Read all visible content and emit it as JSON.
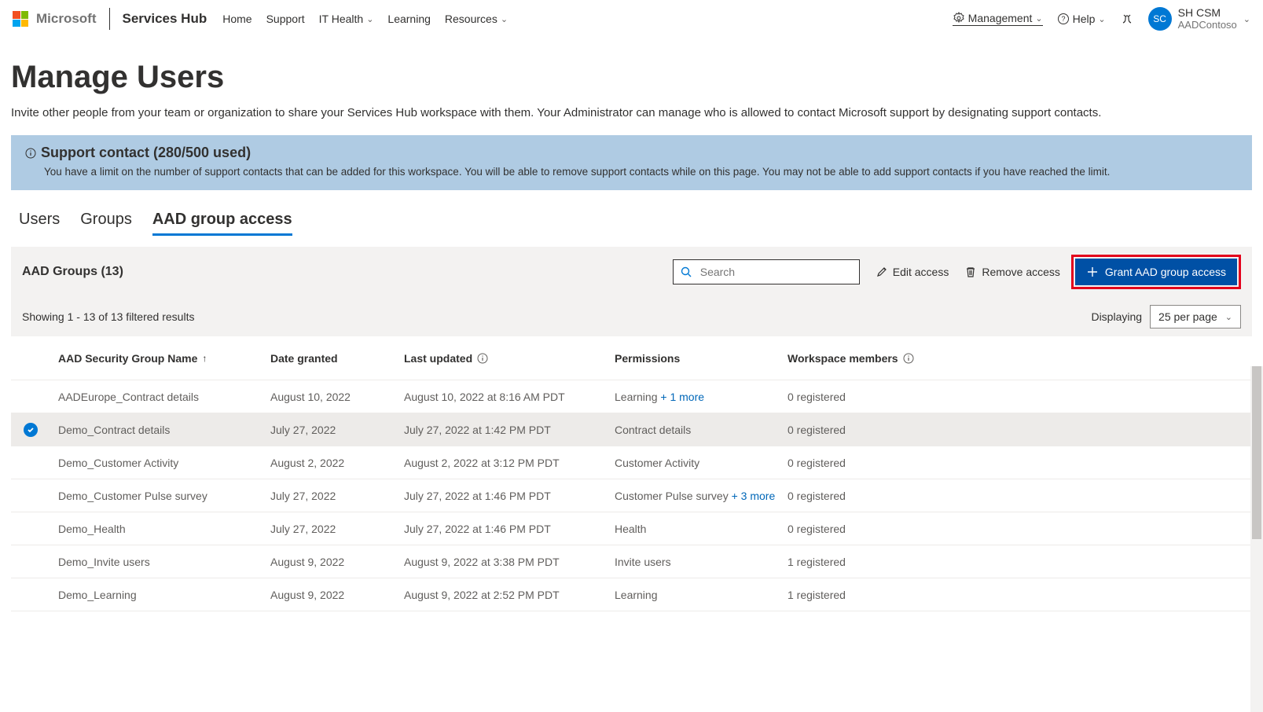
{
  "header": {
    "brand": "Microsoft",
    "app": "Services Hub",
    "nav": [
      "Home",
      "Support",
      "IT Health",
      "Learning",
      "Resources"
    ],
    "management": "Management",
    "help": "Help",
    "user_initials": "SC",
    "user_name": "SH CSM",
    "user_org": "AADContoso"
  },
  "page": {
    "title": "Manage Users",
    "subtitle": "Invite other people from your team or organization to share your Services Hub workspace with them. Your Administrator can manage who is allowed to contact Microsoft support by designating support contacts."
  },
  "banner": {
    "title": "Support contact (280/500 used)",
    "sub": "You have a limit on the number of support contacts that can be added for this workspace. You will be able to remove support contacts while on this page. You may not be able to add support contacts if you have reached the limit."
  },
  "tabs": {
    "items": [
      "Users",
      "Groups",
      "AAD group access"
    ]
  },
  "toolbar": {
    "title": "AAD Groups (13)",
    "search_placeholder": "Search",
    "edit": "Edit access",
    "remove": "Remove access",
    "grant": "Grant AAD group access"
  },
  "results": {
    "showing": "Showing 1 - 13 of 13 filtered results",
    "displaying_label": "Displaying",
    "per_page": "25 per page"
  },
  "columns": {
    "name": "AAD Security Group Name",
    "date": "Date granted",
    "updated": "Last updated",
    "perm": "Permissions",
    "members": "Workspace members"
  },
  "rows": [
    {
      "name": "AADEurope_Contract details",
      "date": "August 10, 2022",
      "updated": "August 10, 2022 at 8:16 AM PDT",
      "perm": "Learning",
      "perm_more": " + 1 more",
      "members": "0 registered",
      "selected": false
    },
    {
      "name": "Demo_Contract details",
      "date": "July 27, 2022",
      "updated": "July 27, 2022 at 1:42 PM PDT",
      "perm": "Contract details",
      "perm_more": "",
      "members": "0 registered",
      "selected": true
    },
    {
      "name": "Demo_Customer Activity",
      "date": "August 2, 2022",
      "updated": "August 2, 2022 at 3:12 PM PDT",
      "perm": "Customer Activity",
      "perm_more": "",
      "members": "0 registered",
      "selected": false
    },
    {
      "name": "Demo_Customer Pulse survey",
      "date": "July 27, 2022",
      "updated": "July 27, 2022 at 1:46 PM PDT",
      "perm": "Customer Pulse survey",
      "perm_more": " + 3 more",
      "members": "0 registered",
      "selected": false
    },
    {
      "name": "Demo_Health",
      "date": "July 27, 2022",
      "updated": "July 27, 2022 at 1:46 PM PDT",
      "perm": "Health",
      "perm_more": "",
      "members": "0 registered",
      "selected": false
    },
    {
      "name": "Demo_Invite users",
      "date": "August 9, 2022",
      "updated": "August 9, 2022 at 3:38 PM PDT",
      "perm": "Invite users",
      "perm_more": "",
      "members": "1 registered",
      "selected": false
    },
    {
      "name": "Demo_Learning",
      "date": "August 9, 2022",
      "updated": "August 9, 2022 at 2:52 PM PDT",
      "perm": "Learning",
      "perm_more": "",
      "members": "1 registered",
      "selected": false
    }
  ]
}
